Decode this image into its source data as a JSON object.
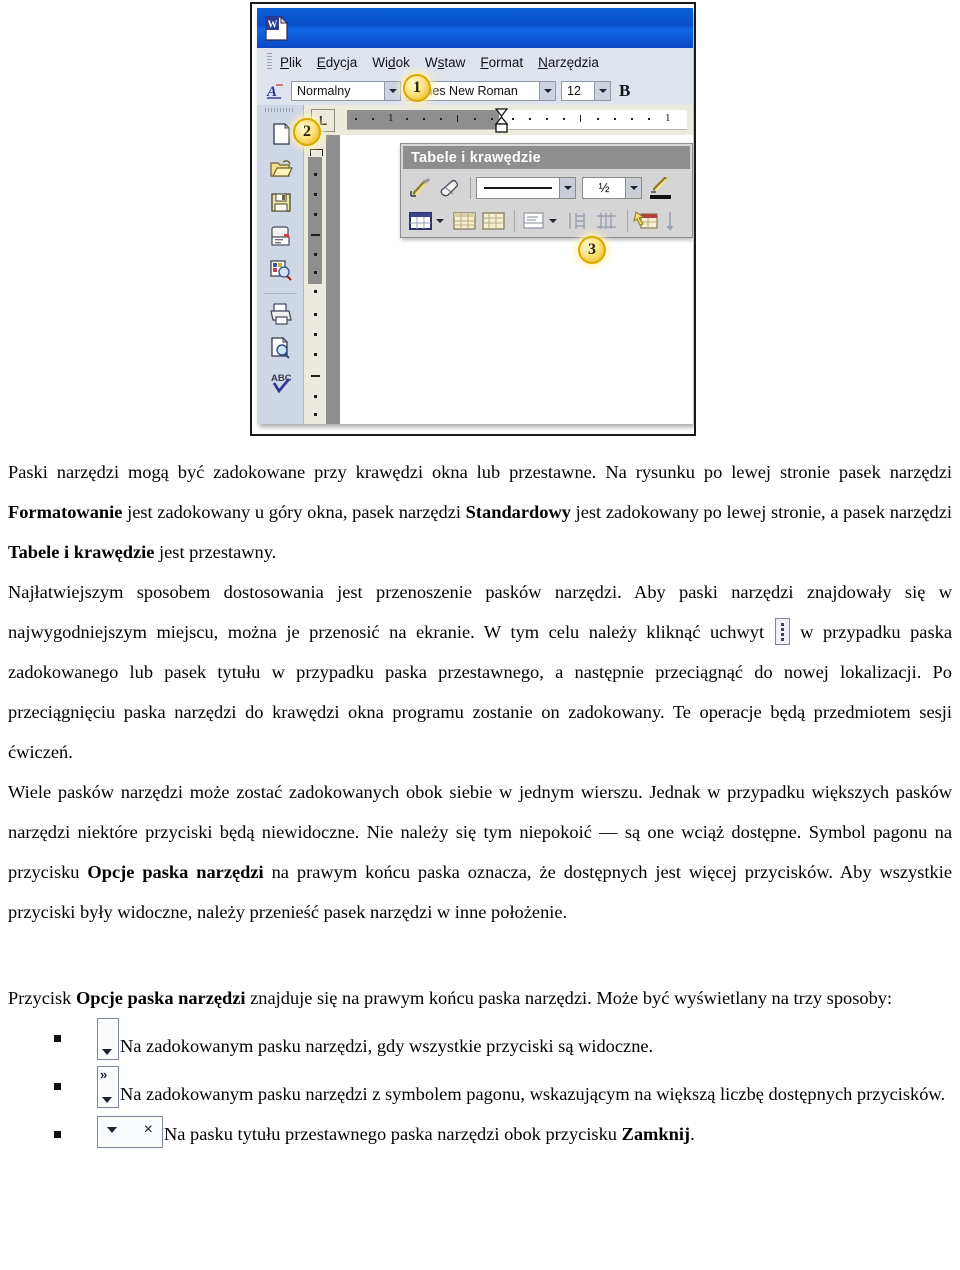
{
  "figure": {
    "app_icon": "word-document-icon",
    "menu_items": [
      {
        "label": "Plik",
        "accel": "P"
      },
      {
        "label": "Edycja",
        "accel": "E"
      },
      {
        "label": "Widok",
        "accel": "d"
      },
      {
        "label": "Wstaw",
        "accel": "s"
      },
      {
        "label": "Format",
        "accel": "F"
      },
      {
        "label": "Narzędzia",
        "accel": "N"
      }
    ],
    "formatting_toolbar": {
      "style_value": "Normalny",
      "font_value": "Times New Roman",
      "size_value": "12",
      "bold_label": "B"
    },
    "ruler": {
      "tab_selector": "L",
      "left_number": "1",
      "right_number": "1"
    },
    "standard_toolbar_icons": [
      "new-document-icon",
      "open-folder-icon",
      "save-icon",
      "email-icon",
      "search-web-icon",
      "print-icon",
      "print-preview-icon",
      "spellcheck-icon"
    ],
    "floating_toolbar": {
      "title": "Tabele i krawędzie",
      "line_weight": "½",
      "row1_icons": [
        "draw-table-pencil-icon",
        "eraser-icon",
        "line-style-combo",
        "line-weight-combo",
        "border-color-pencil-icon"
      ],
      "row2_icons": [
        "outside-border-icon",
        "shading-color-icon",
        "insert-table-icon",
        "merge-cells-icon",
        "align-icon",
        "distribute-rows-icon",
        "distribute-columns-icon",
        "table-autoformat-icon",
        "sort-icon"
      ]
    },
    "callouts": [
      {
        "number": "1"
      },
      {
        "number": "2"
      },
      {
        "number": "3"
      }
    ]
  },
  "body": {
    "p1": {
      "a": "Paski narzędzi mogą być zadokowane przy krawędzi okna lub przestawne. Na rysunku po lewej stronie pasek narzędzi ",
      "b_formatowanie": "Formatowanie",
      "c": " jest zadokowany u góry okna, pasek narzędzi ",
      "b_standardowy": "Standardowy",
      "d": " jest zadokowany po lewej stronie, a pasek narzędzi ",
      "b_tabele": "Tabele i krawędzie",
      "e": " jest przestawny."
    },
    "p2": {
      "a": "Najłatwiejszym sposobem dostosowania jest przenoszenie pasków narzędzi. Aby paski narzędzi znajdowały się w najwygodniejszym miejscu, można je przenosić na ekranie. W tym celu należy kliknąć uchwyt ",
      "icon": "toolbar-grip-handle-icon",
      "b": " w przypadku paska zadokowanego lub pasek tytułu w przypadku paska przestawnego, a następnie przeciągnąć do nowej lokalizacji. Po przeciągnięciu paska narzędzi do krawędzi okna programu zostanie on zadokowany. Te operacje będą przedmiotem sesji ćwiczeń."
    },
    "p3": {
      "a": "Wiele pasków narzędzi może zostać zadokowanych obok siebie w jednym wierszu. Jednak w przypadku większych pasków narzędzi niektóre przyciski będą niewidoczne. Nie należy się tym niepokoić — są one wciąż dostępne. Symbol pagonu na przycisku ",
      "b_opcje": "Opcje paska narzędzi",
      "c": " na prawym końcu paska oznacza, że dostępnych jest więcej przycisków. Aby wszystkie przyciski były widoczne, należy przenieść pasek narzędzi w inne położenie."
    },
    "p4": {
      "a": "Przycisk ",
      "b_opcje": "Opcje paska narzędzi",
      "c": " znajduje się na prawym końcu paska narzędzi. Może być wyświetlany na trzy sposoby:"
    },
    "bullets": [
      {
        "icon": "toolbar-options-docked-icon",
        "text": "Na zadokowanym pasku narzędzi, gdy wszystkie przyciski są widoczne."
      },
      {
        "icon": "toolbar-options-chevron-icon",
        "chevron": "»",
        "text": "Na zadokowanym pasku narzędzi z symbolem pagonu, wskazującym na większą liczbę dostępnych przycisków."
      },
      {
        "icon": "toolbar-options-floating-icon",
        "close_glyph": "×",
        "text_before": "Na pasku tytułu przestawnego paska narzędzi obok przycisku ",
        "bold": "Zamknij",
        "text_after": "."
      }
    ]
  },
  "colors": {
    "titlebar_blue": "#0a4fcc",
    "toolbar_bg": "#dfe3ee",
    "float_toolbar_title": "#8e8e8e",
    "callout_gold": "#fbe27a",
    "page_white": "#ffffff"
  }
}
